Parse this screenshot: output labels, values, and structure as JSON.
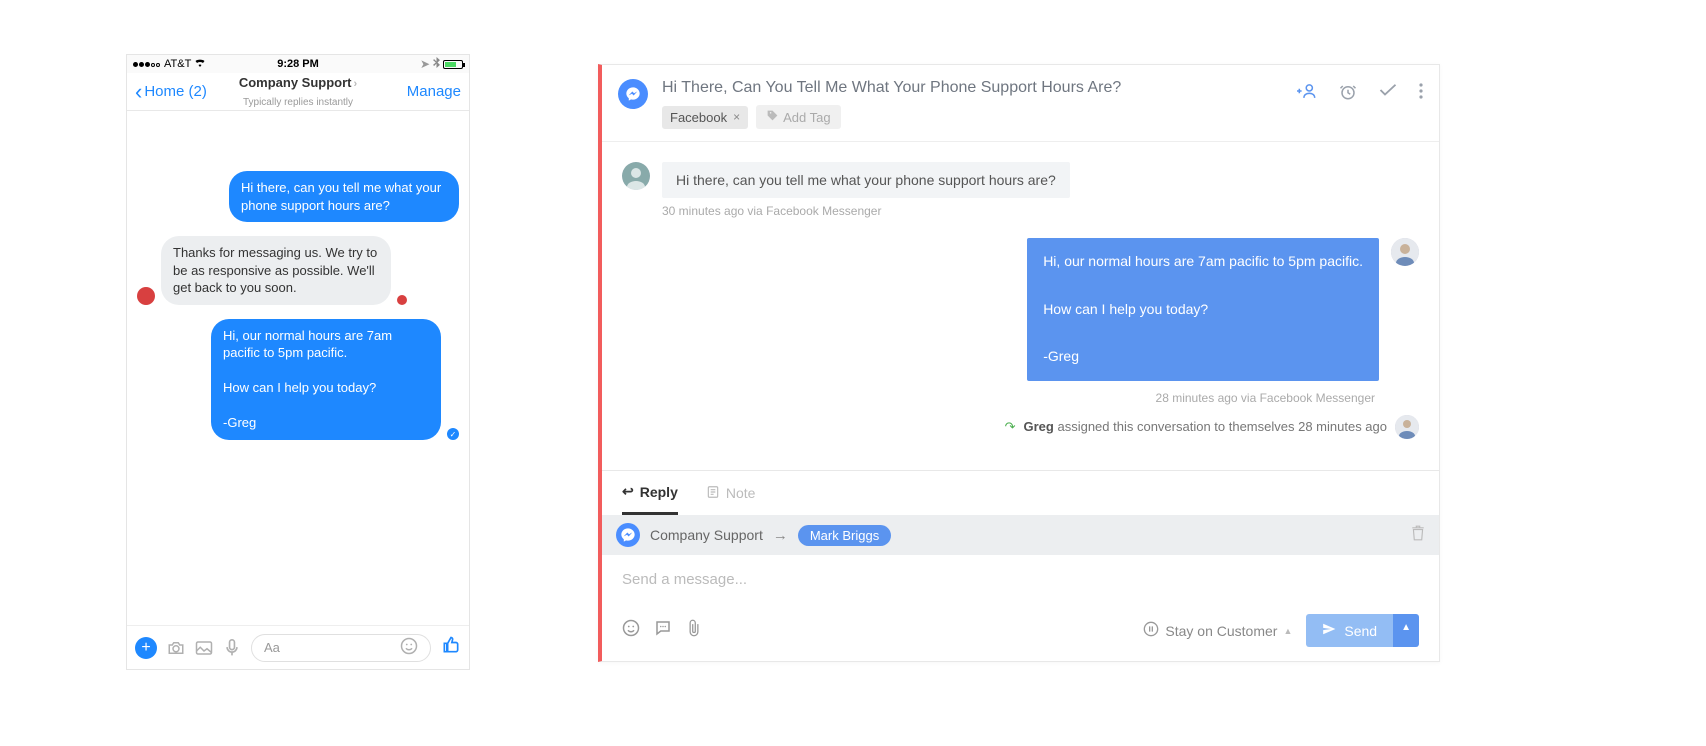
{
  "phone": {
    "status": {
      "carrier": "AT&T",
      "time": "9:28 PM"
    },
    "header": {
      "back_label": "Home (2)",
      "title": "Company Support",
      "subtitle": "Typically replies instantly",
      "manage": "Manage"
    },
    "messages": {
      "m1": "Hi there, can you tell me what your phone support hours are?",
      "m2": "Thanks for messaging us. We try to be as responsive as possible. We'll get back to you soon.",
      "m3": "Hi, our normal hours are 7am pacific to 5pm pacific.\n\nHow can I help you today?\n\n-Greg"
    },
    "composer": {
      "placeholder": "Aa"
    }
  },
  "panel": {
    "title": "Hi There, Can You Tell Me What Your Phone Support Hours Are?",
    "tag": "Facebook",
    "add_tag": "Add Tag",
    "inbound": {
      "text": "Hi there, can you tell me what your phone support hours are?",
      "meta": "30 minutes ago via Facebook Messenger"
    },
    "outbound": {
      "text": "Hi, our normal hours are 7am pacific to 5pm pacific.\n\nHow can I help you today?\n\n-Greg",
      "meta": "28 minutes ago via Facebook Messenger"
    },
    "assignment": {
      "actor": "Greg",
      "text": " assigned this conversation to themselves 28 minutes ago"
    },
    "footer": {
      "tab_reply": "Reply",
      "tab_note": "Note",
      "from": "Company Support",
      "to": "Mark Briggs",
      "placeholder": "Send a message...",
      "stay": "Stay on Customer",
      "send": "Send"
    }
  }
}
